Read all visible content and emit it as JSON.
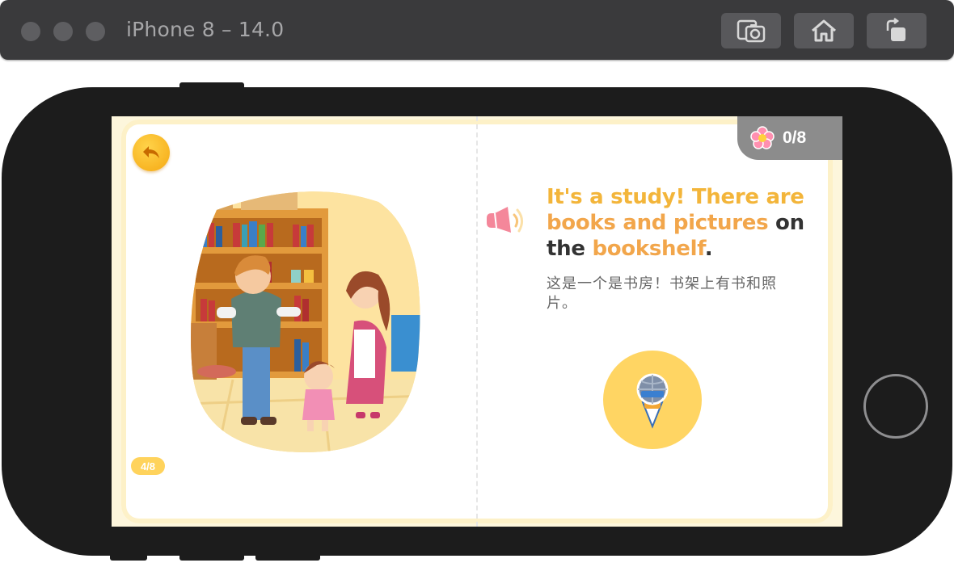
{
  "simulator": {
    "title": "iPhone 8 – 14.0",
    "buttons": [
      {
        "name": "screenshot",
        "icon": "camera-icon"
      },
      {
        "name": "home",
        "icon": "home-icon"
      },
      {
        "name": "rotate",
        "icon": "rotate-icon"
      }
    ]
  },
  "app": {
    "page_indicator": "4/8",
    "score": "0/8",
    "sentence": {
      "part1": "It's a study! There are ",
      "part2": "books and pictures",
      "part3": " on the ",
      "part4": "bookshelf",
      "part5": "."
    },
    "translation": "这是一个是书房！书架上有书和照片。"
  },
  "colors": {
    "accent_yellow": "#f3b53a",
    "accent_orange": "#f2a64b",
    "mic_bg": "#ffd563",
    "score_bg": "#8c8c8c"
  }
}
